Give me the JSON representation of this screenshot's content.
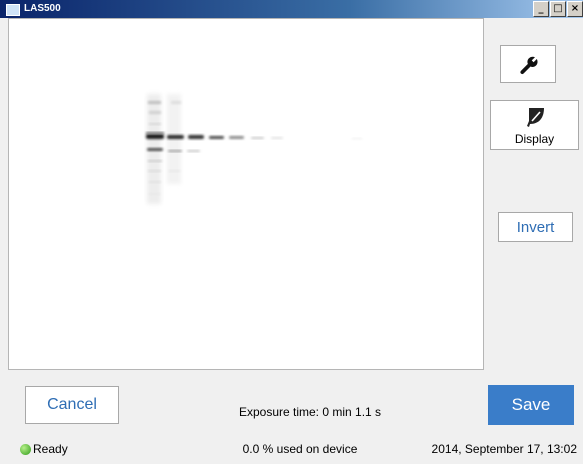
{
  "window": {
    "title": "LAS500",
    "controls": [
      "minimize",
      "restore",
      "close"
    ],
    "control_glyphs": [
      "_",
      "□",
      "×"
    ]
  },
  "toolbar": {
    "settings_icon": "wrench-icon",
    "display_icon": "display-leaf-icon",
    "display_label": "Display",
    "invert_label": "Invert"
  },
  "actions": {
    "cancel_label": "Cancel",
    "save_label": "Save"
  },
  "exposure": {
    "label": "Exposure time: 0 min 1.1 s"
  },
  "status": {
    "state": "Ready",
    "state_color": "#3cb521",
    "usage": "0.0 % used on device",
    "datetime": "2014, September 17, 13:02"
  },
  "colors": {
    "accent": "#3a7dc9",
    "link_text": "#2e6db4",
    "viewer_bg": "#ffffff",
    "window_bg": "#f0f0f0"
  }
}
